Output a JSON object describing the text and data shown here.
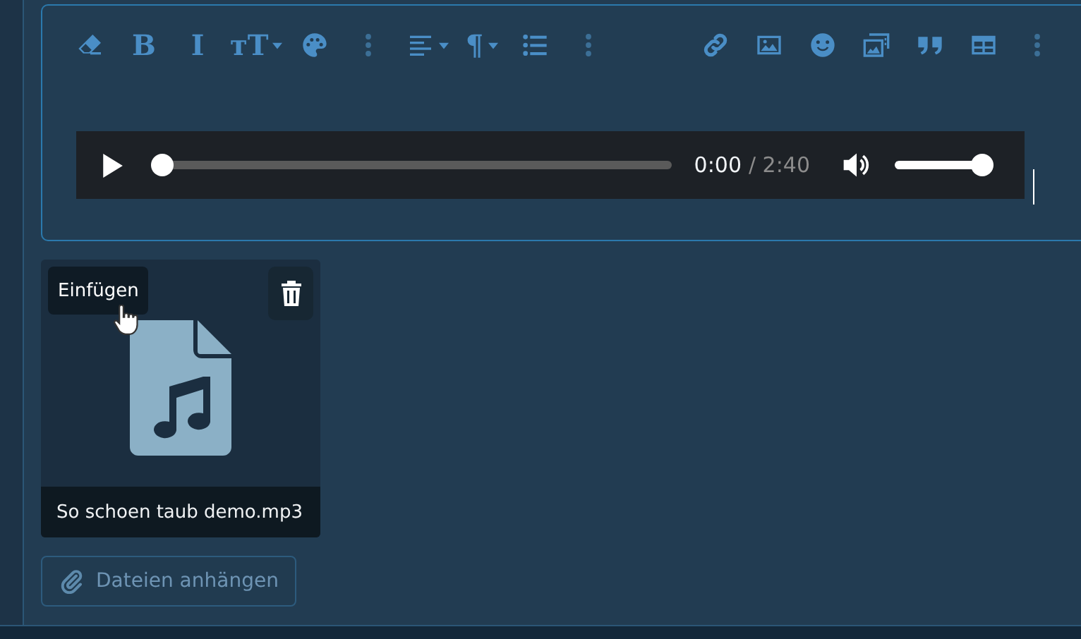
{
  "editor": {
    "toolbar": {
      "left": [
        {
          "kind": "icon",
          "has_menu": false
        },
        {
          "kind": "glyph",
          "text": "B",
          "has_menu": false
        },
        {
          "kind": "glyph",
          "text": "I",
          "has_menu": false
        },
        {
          "kind": "glyph",
          "text": "ᴛT",
          "has_menu": true
        },
        {
          "kind": "icon",
          "has_menu": false
        },
        {
          "kind": "more",
          "has_menu": false
        },
        {
          "kind": "icon",
          "has_menu": true
        },
        {
          "kind": "glyph",
          "text": "¶",
          "has_menu": true
        },
        {
          "kind": "icon",
          "has_menu": false
        },
        {
          "kind": "more",
          "has_menu": false
        }
      ],
      "right": [
        {
          "kind": "icon",
          "has_menu": false
        },
        {
          "kind": "icon",
          "has_menu": false
        },
        {
          "kind": "icon",
          "has_menu": false
        },
        {
          "kind": "icon",
          "has_menu": false
        },
        {
          "kind": "icon",
          "has_menu": false
        },
        {
          "kind": "icon",
          "has_menu": false
        },
        {
          "kind": "more",
          "has_menu": false
        }
      ]
    },
    "audio_player": {
      "position": "0:00",
      "duration": "/ 2:40",
      "progress": {
        "level": 0
      },
      "volume": {
        "level": 1
      }
    }
  },
  "attachments": [
    {
      "kind": "audio",
      "insert_label": "Einfügen",
      "name": "So schoen taub demo.mp3"
    }
  ],
  "attach_button": "Dateien anhängen"
}
